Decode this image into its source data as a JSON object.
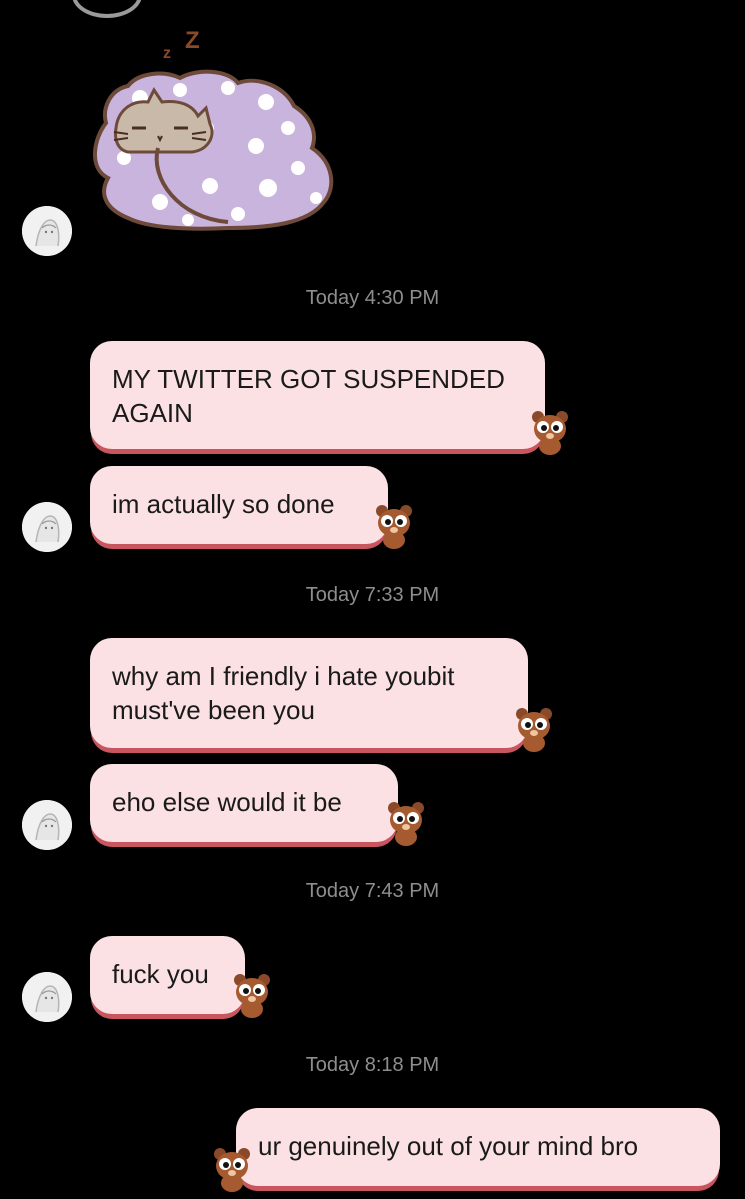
{
  "timestamps": {
    "t1": "Today 4:30 PM",
    "t2": "Today 7:33 PM",
    "t3": "Today 7:43 PM",
    "t4": "Today 8:18 PM"
  },
  "sticker": {
    "icon": "sleeping-cat-sticker",
    "zz": "z",
    "zz2": "Z"
  },
  "messages": [
    {
      "text": "MY TWITTER GOT SUSPENDED\nAGAIN",
      "sender": "other"
    },
    {
      "text": "im actually so done",
      "sender": "other"
    },
    {
      "text": "why am I friendly i hate youbit\nmust've been you",
      "sender": "other"
    },
    {
      "text": "eho else would it be",
      "sender": "other"
    },
    {
      "text": "fuck you",
      "sender": "other"
    },
    {
      "text": "ur genuinely out of your mind bro",
      "sender": "me"
    }
  ],
  "colors": {
    "background": "#000000",
    "bubble": "#fce1e4",
    "bubble_border": "#c9555f",
    "timestamp": "#8e8e8e"
  }
}
